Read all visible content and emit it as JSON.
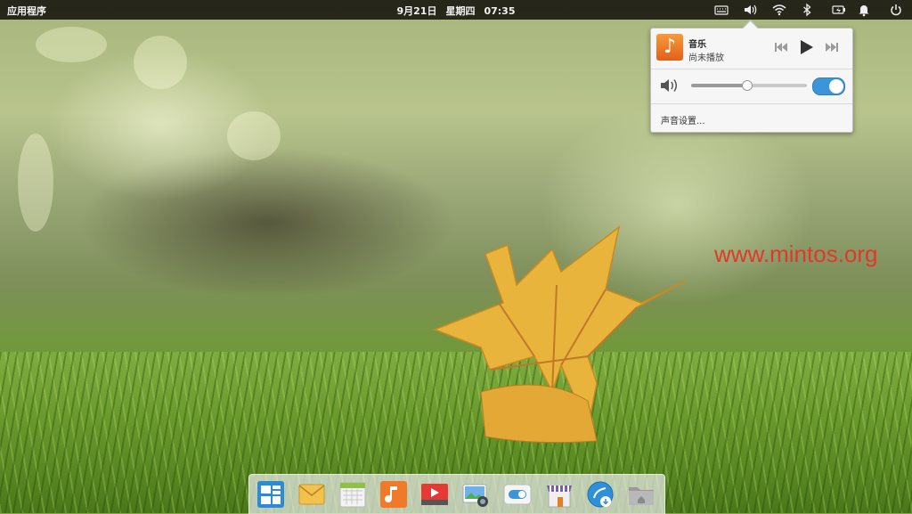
{
  "topbar": {
    "apps_label": "应用程序",
    "date": "9月21日",
    "weekday": "星期四",
    "time": "07:35",
    "tray_icons": [
      "keyboard-icon",
      "volume-icon",
      "wifi-icon",
      "bluetooth-icon",
      "battery-icon",
      "notification-bell-icon",
      "power-icon"
    ]
  },
  "sound_popover": {
    "player_name": "音乐",
    "player_status": "尚未播放",
    "volume_percent": 48,
    "output_enabled": true,
    "settings_label": "声音设置..."
  },
  "watermark": "www.mintos.org",
  "dock": {
    "items": [
      "multitasking-view-icon",
      "mail-icon",
      "calendar-icon",
      "music-icon",
      "videos-icon",
      "photos-icon",
      "settings-icon",
      "app-store-icon",
      "downloader-icon",
      "file-manager-icon"
    ]
  },
  "colors": {
    "accent_blue": "#3d95d9",
    "music_orange": "#f07a2a",
    "watermark_red": "#e0392a",
    "panel_bg": "#14120c"
  }
}
